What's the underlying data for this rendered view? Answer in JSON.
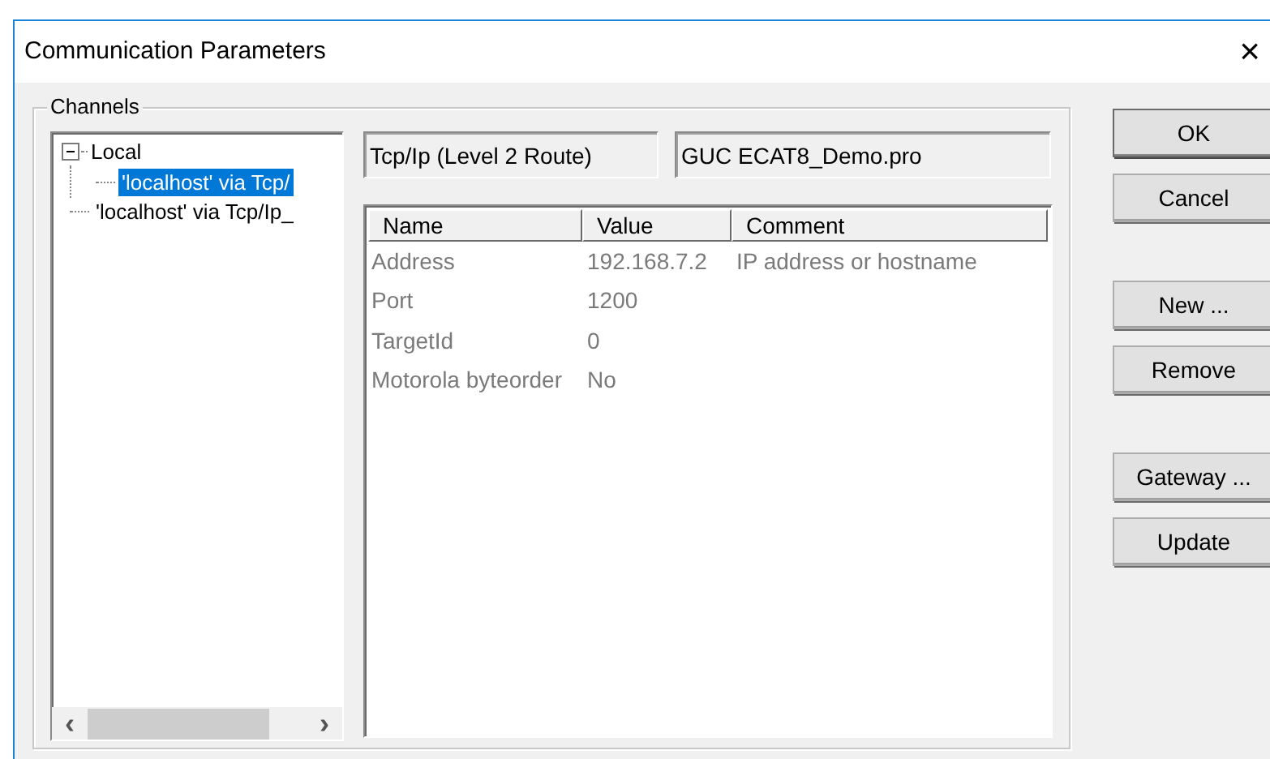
{
  "window": {
    "title": "Communication Parameters",
    "close": "×"
  },
  "group": {
    "label": "Channels"
  },
  "tree": [
    {
      "label": "Local",
      "expanded": true,
      "selected": false,
      "children": [
        {
          "label": "'localhost' via Tcp/",
          "selected": true
        }
      ]
    },
    {
      "label": "'localhost' via Tcp/Ip_",
      "selected": false
    }
  ],
  "tree_scroll": {
    "left": "‹",
    "right": "›"
  },
  "fields": [
    "Tcp/Ip (Level 2 Route)",
    "GUC ECAT8_Demo.pro"
  ],
  "table": {
    "columns": [
      "Name",
      "Value",
      "Comment"
    ],
    "rows": [
      [
        "Address",
        "192.168.7.2",
        "IP address or hostname"
      ],
      [
        "Port",
        "1200",
        ""
      ],
      [
        "TargetId",
        "0",
        ""
      ],
      [
        "Motorola byteorder",
        "No",
        ""
      ]
    ]
  },
  "buttons": [
    {
      "label": "OK",
      "default": true
    },
    {
      "label": "Cancel",
      "default": false
    },
    {
      "label": "New ...",
      "default": false
    },
    {
      "label": "Remove",
      "default": false
    },
    {
      "label": "Gateway ...",
      "default": false
    },
    {
      "label": "Update",
      "default": false
    }
  ]
}
